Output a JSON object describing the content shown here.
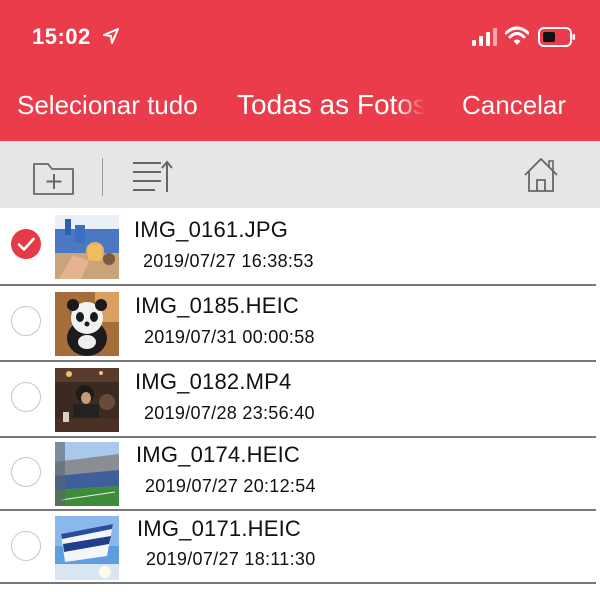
{
  "status_bar": {
    "time": "15:02",
    "location_icon": "location-arrow-icon",
    "signal_icon": "cellular-signal-icon",
    "wifi_icon": "wifi-icon",
    "battery_icon": "battery-icon"
  },
  "nav": {
    "select_all": "Selecionar tudo",
    "title": "Todas as Fotos",
    "cancel": "Cancelar"
  },
  "toolbar": {
    "new_folder_icon": "folder-add-icon",
    "sort_icon": "sort-list-icon",
    "home_icon": "home-icon"
  },
  "colors": {
    "brand": "#ea3c4a",
    "toolbar_bg": "#e6e6e6",
    "check_selected": "#e53a47"
  },
  "files": [
    {
      "name": "IMG_0161.JPG",
      "date": "2019/07/27 16:38:53",
      "selected": true,
      "thumb": "stadium-crowd-drink-photo"
    },
    {
      "name": "IMG_0185.HEIC",
      "date": "2019/07/31 00:00:58",
      "selected": false,
      "thumb": "panda-plush-photo"
    },
    {
      "name": "IMG_0182.MP4",
      "date": "2019/07/28 23:56:40",
      "selected": false,
      "thumb": "bar-people-video"
    },
    {
      "name": "IMG_0174.HEIC",
      "date": "2019/07/27 20:12:54",
      "selected": false,
      "thumb": "stadium-interior-photo"
    },
    {
      "name": "IMG_0171.HEIC",
      "date": "2019/07/27 18:11:30",
      "selected": false,
      "thumb": "flag-sky-photo"
    }
  ]
}
